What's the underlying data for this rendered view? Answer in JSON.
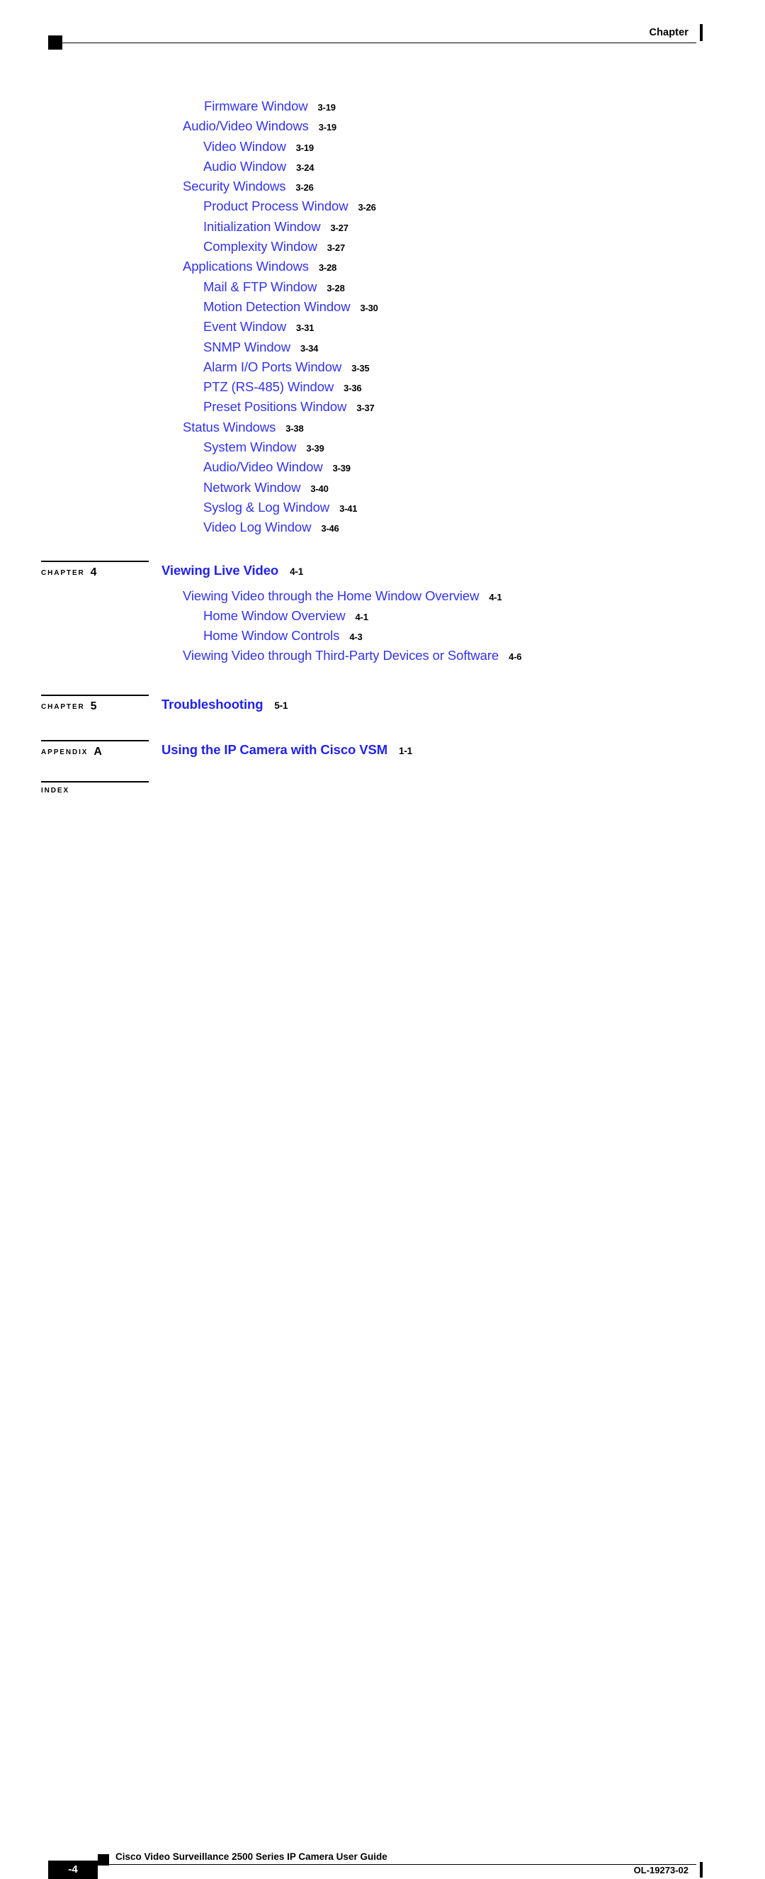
{
  "header": {
    "label": "Chapter"
  },
  "toc": {
    "entries": [
      {
        "title": "Firmware Window",
        "page": "3-19",
        "level": 4
      },
      {
        "title": "Audio/Video Windows",
        "page": "3-19",
        "level": 2
      },
      {
        "title": "Video Window",
        "page": "3-19",
        "level": 3
      },
      {
        "title": "Audio Window",
        "page": "3-24",
        "level": 3
      },
      {
        "title": "Security Windows",
        "page": "3-26",
        "level": 2
      },
      {
        "title": "Product Process Window",
        "page": "3-26",
        "level": 3
      },
      {
        "title": "Initialization Window",
        "page": "3-27",
        "level": 3
      },
      {
        "title": "Complexity Window",
        "page": "3-27",
        "level": 3
      },
      {
        "title": "Applications Windows",
        "page": "3-28",
        "level": 2
      },
      {
        "title": "Mail & FTP Window",
        "page": "3-28",
        "level": 3
      },
      {
        "title": "Motion Detection Window",
        "page": "3-30",
        "level": 3
      },
      {
        "title": "Event Window",
        "page": "3-31",
        "level": 3
      },
      {
        "title": "SNMP Window",
        "page": "3-34",
        "level": 3
      },
      {
        "title": "Alarm I/O Ports Window",
        "page": "3-35",
        "level": 3
      },
      {
        "title": "PTZ (RS-485) Window",
        "page": "3-36",
        "level": 3
      },
      {
        "title": "Preset Positions Window",
        "page": "3-37",
        "level": 3
      },
      {
        "title": "Status Windows",
        "page": "3-38",
        "level": 2
      },
      {
        "title": "System Window",
        "page": "3-39",
        "level": 3
      },
      {
        "title": "Audio/Video Window",
        "page": "3-39",
        "level": 3
      },
      {
        "title": "Network Window",
        "page": "3-40",
        "level": 3
      },
      {
        "title": "Syslog & Log Window",
        "page": "3-41",
        "level": 3
      },
      {
        "title": "Video Log Window",
        "page": "3-46",
        "level": 3
      }
    ]
  },
  "chapters": [
    {
      "label": "CHAPTER",
      "number": "4",
      "title": "Viewing Live Video",
      "page": "4-1",
      "entries": [
        {
          "title": "Viewing Video through the Home Window Overview",
          "page": "4-1",
          "level": 2
        },
        {
          "title": "Home Window Overview",
          "page": "4-1",
          "level": 3
        },
        {
          "title": "Home Window Controls",
          "page": "4-3",
          "level": 3
        },
        {
          "title": "Viewing Video through Third-Party Devices or Software",
          "page": "4-6",
          "level": 2
        }
      ]
    },
    {
      "label": "CHAPTER",
      "number": "5",
      "title": "Troubleshooting",
      "page": "5-1",
      "entries": []
    },
    {
      "label": "APPENDIX",
      "number": "A",
      "title": "Using the IP Camera with Cisco VSM",
      "page": "1-1",
      "entries": []
    },
    {
      "label": "INDEX",
      "number": "",
      "title": "",
      "page": "",
      "entries": []
    }
  ],
  "footer": {
    "page_number": "-4",
    "document_title": "Cisco Video Surveillance 2500 Series IP Camera User Guide",
    "doc_id": "OL-19273-02"
  },
  "colors": {
    "link_blue": "#3333ee",
    "heading_blue": "#2222ee",
    "text_black": "#000000"
  }
}
